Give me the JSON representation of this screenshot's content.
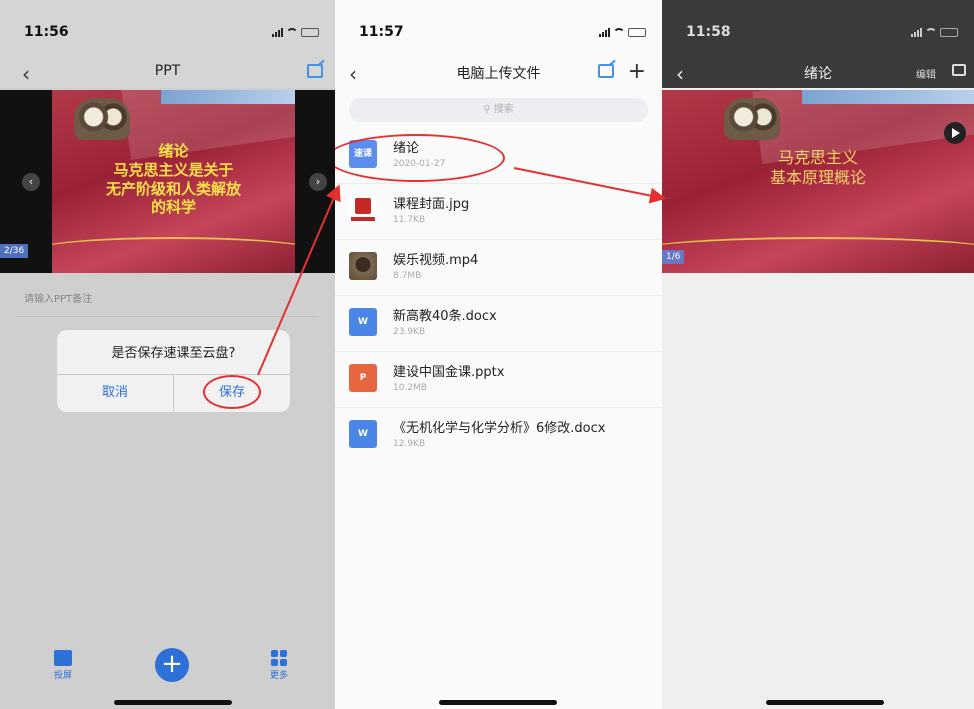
{
  "phone1": {
    "time": "11:56",
    "nav_title": "PPT",
    "slide": {
      "title": "绪论",
      "lines": [
        "马克思主义是关于",
        "无产阶级和人类解放",
        "的科学"
      ],
      "pager": "2/36"
    },
    "note_placeholder": "请输入PPT备注",
    "dialog": {
      "question": "是否保存速课至云盘?",
      "cancel": "取消",
      "save": "保存"
    },
    "tabs": {
      "cast": "投屏",
      "more": "更多"
    }
  },
  "phone2": {
    "time": "11:57",
    "nav_title": "电脑上传文件",
    "search_placeholder": "搜索",
    "files": [
      {
        "name": "绪论",
        "meta": "2020-01-27",
        "icon_text": "速课",
        "color": "#5b8def"
      },
      {
        "name": "课程封面.jpg",
        "meta": "11.7KB",
        "icon_text": "",
        "color": "#ffffff"
      },
      {
        "name": "娱乐视频.mp4",
        "meta": "8.7MB",
        "icon_text": "",
        "color": "#6b5a44"
      },
      {
        "name": "新高教40条.docx",
        "meta": "23.9KB",
        "icon_text": "W",
        "color": "#4a86e8"
      },
      {
        "name": "建设中国金课.pptx",
        "meta": "10.2MB",
        "icon_text": "P",
        "color": "#e8663f"
      },
      {
        "name": "《无机化学与化学分析》6修改.docx",
        "meta": "12.9KB",
        "icon_text": "W",
        "color": "#4a86e8"
      }
    ]
  },
  "phone3": {
    "time": "11:58",
    "nav_title": "绪论",
    "edit": "编辑",
    "slide": {
      "lines": [
        "马克思主义",
        "基本原理概论"
      ],
      "pager": "1/6"
    }
  }
}
